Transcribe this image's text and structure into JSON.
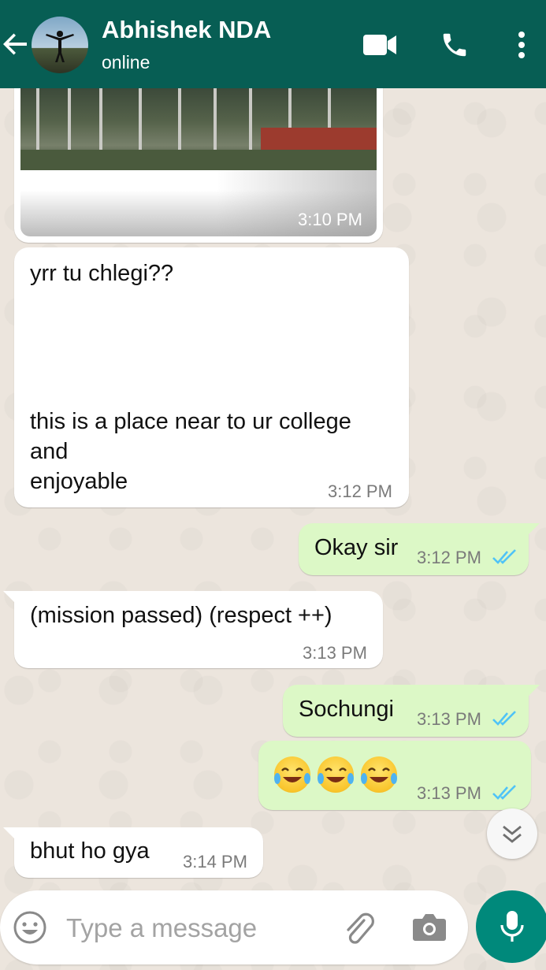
{
  "header": {
    "contact_name": "Abhishek NDA",
    "status": "online",
    "back_icon": "arrow-left-icon",
    "video_icon": "videocam-icon",
    "call_icon": "phone-icon",
    "menu_icon": "more-vert-icon",
    "color": "#075e54"
  },
  "messages": [
    {
      "direction": "incoming",
      "type": "image",
      "time": "3:10 PM"
    },
    {
      "direction": "incoming",
      "lines": [
        "yrr tu chlegi??",
        "",
        "",
        "",
        "",
        "this is a place near to ur college",
        "and",
        "enjoyable"
      ],
      "line1": "yrr tu chlegi??",
      "line2": "this is a place near to ur college",
      "line3": "and",
      "line4": "enjoyable",
      "time": "3:12 PM"
    },
    {
      "direction": "outgoing",
      "text": "Okay sir",
      "time": "3:12 PM",
      "status": "read"
    },
    {
      "direction": "incoming",
      "text": "(mission passed) (respect ++)",
      "time": "3:13 PM"
    },
    {
      "direction": "outgoing",
      "text": "Sochungi",
      "time": "3:13 PM",
      "status": "read"
    },
    {
      "direction": "outgoing",
      "text": "😂😂😂",
      "emoji": "face-with-tears-of-joy",
      "time": "3:13 PM",
      "status": "read"
    },
    {
      "direction": "incoming",
      "text": "bhut ho gya",
      "time": "3:14 PM"
    }
  ],
  "composer": {
    "placeholder": "Type a message",
    "emoji_icon": "emoji-icon",
    "attach_icon": "paperclip-icon",
    "camera_icon": "camera-icon",
    "mic_icon": "mic-icon"
  },
  "colors": {
    "outgoing_bubble": "#dcf8c6",
    "incoming_bubble": "#ffffff",
    "read_ticks": "#4fc3f7",
    "send_button": "#00897b",
    "wallpaper": "#ece5dd"
  }
}
